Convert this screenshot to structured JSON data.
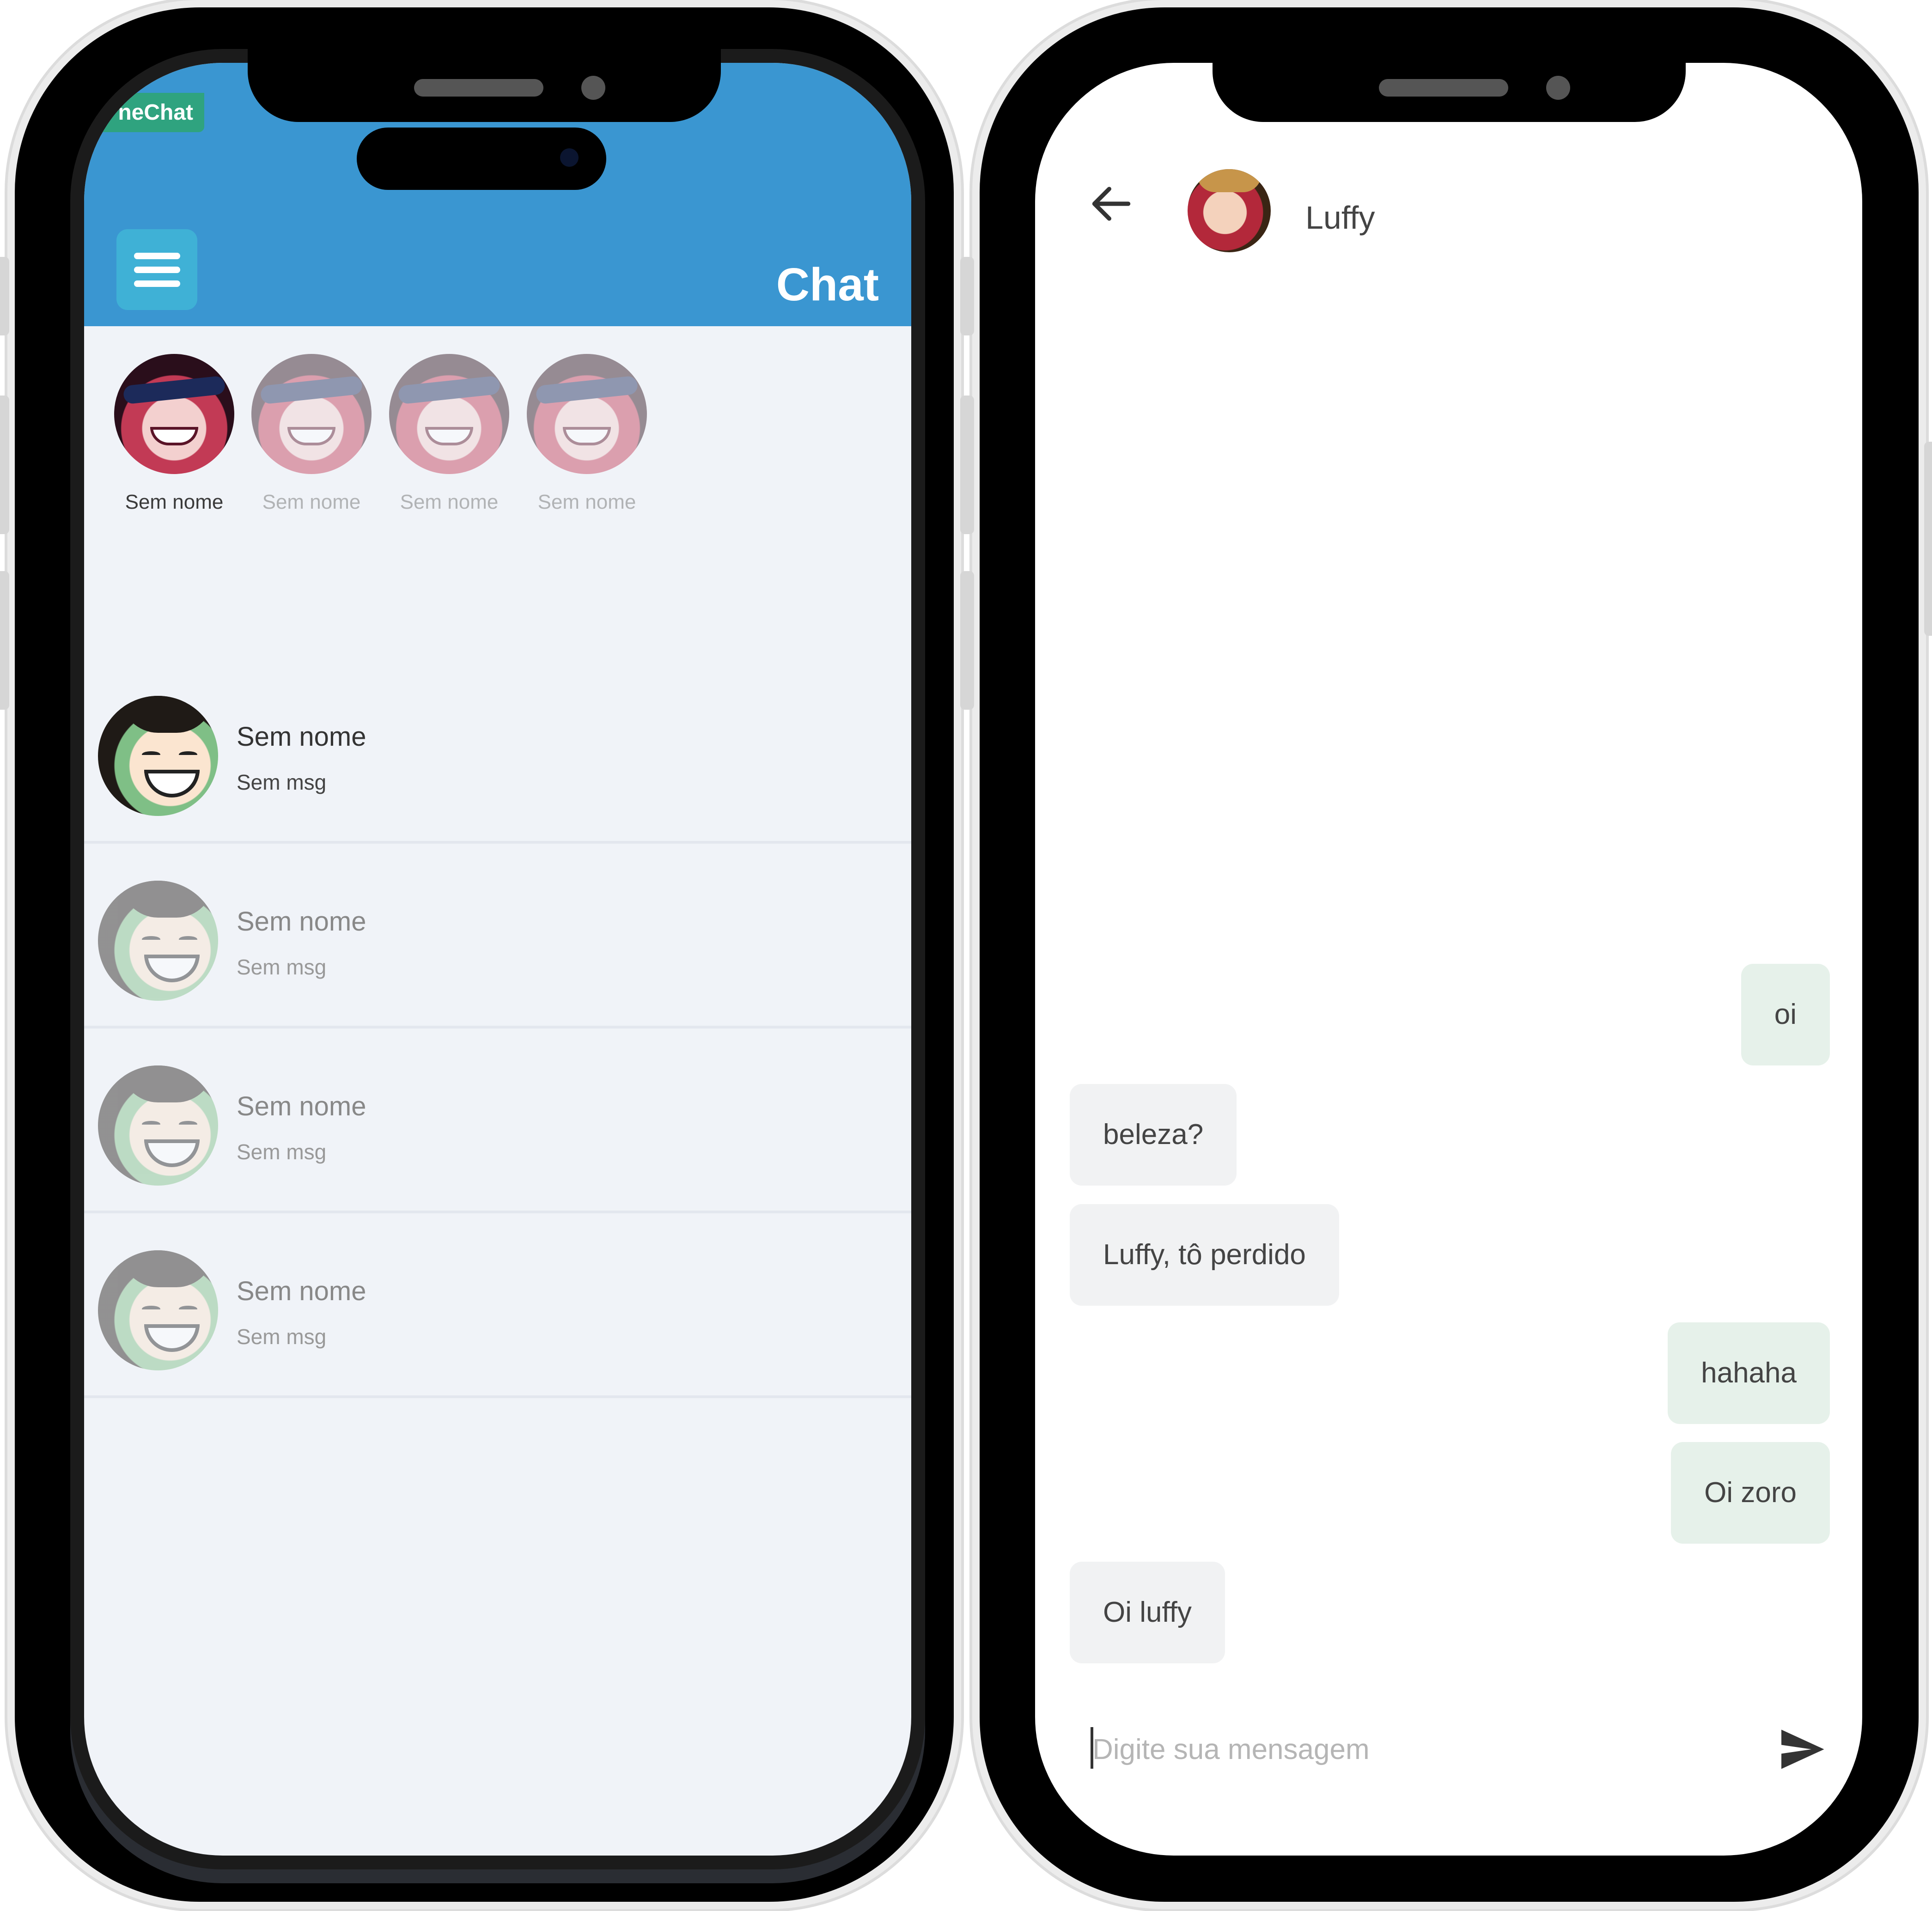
{
  "left_screen": {
    "brand": "neChat",
    "title": "Chat",
    "stories": [
      {
        "label": "Sem nome"
      },
      {
        "label": "Sem nome"
      },
      {
        "label": "Sem nome"
      },
      {
        "label": "Sem nome"
      }
    ],
    "conversations": [
      {
        "name": "Sem nome",
        "message": "Sem msg"
      },
      {
        "name": "Sem nome",
        "message": "Sem msg"
      },
      {
        "name": "Sem nome",
        "message": "Sem msg"
      },
      {
        "name": "Sem nome",
        "message": "Sem msg"
      }
    ]
  },
  "right_screen": {
    "contact_name": "Luffy",
    "messages": [
      {
        "text": "oi",
        "direction": "outgoing"
      },
      {
        "text": "beleza?",
        "direction": "incoming"
      },
      {
        "text": "Luffy, tô perdido",
        "direction": "incoming"
      },
      {
        "text": "hahaha",
        "direction": "outgoing"
      },
      {
        "text": "Oi zoro",
        "direction": "outgoing"
      },
      {
        "text": "Oi luffy",
        "direction": "incoming"
      }
    ],
    "composer": {
      "placeholder": "Digite sua mensagem"
    }
  },
  "colors": {
    "app_bar": "#3a96d1",
    "menu_button": "#3fb1d6",
    "brand_tag": "#2fa37f",
    "list_background": "#f0f3f8",
    "outgoing_bubble": "#e6f1ea",
    "incoming_bubble": "#f1f2f3"
  },
  "icons": [
    "menu-icon",
    "back-arrow-icon",
    "send-icon"
  ]
}
